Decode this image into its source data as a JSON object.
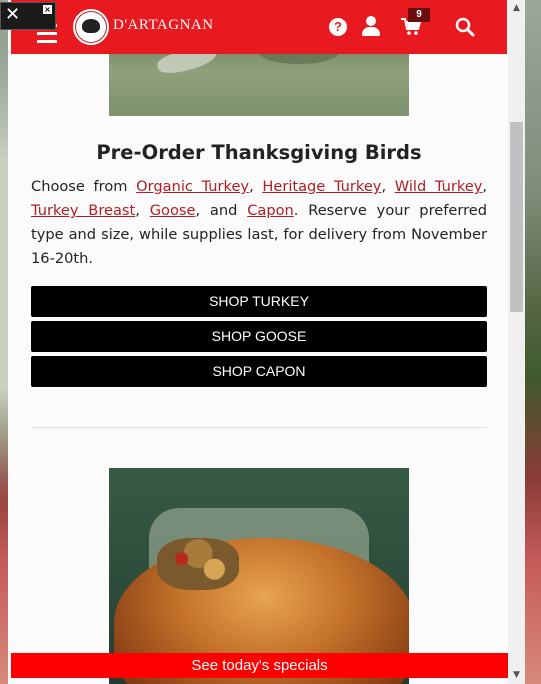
{
  "header": {
    "brand": "D'ARTAGNAN",
    "cart_count": "9",
    "help_label": "?"
  },
  "devtool": {
    "close_label": "×"
  },
  "section": {
    "title": "Pre-Order Thanksgiving Birds",
    "intro_text": "Choose from",
    "links": [
      "Organic Turkey",
      "Heritage Turkey",
      "Wild Turkey",
      "Turkey Breast",
      "Goose",
      "Capon"
    ],
    "connector_and": "and",
    "tail_text": ". Reserve your preferred type and size, while supplies last, for delivery from November 16-20th.",
    "buttons": [
      "SHOP TURKEY",
      "SHOP GOOSE",
      "SHOP CAPON"
    ]
  },
  "footer_bar": {
    "label": "See today's specials"
  },
  "scrollbar": {
    "up": "▲",
    "down": "▼"
  },
  "colors": {
    "brand_red": "#e8191f",
    "link_red": "#b11e24",
    "specials_red": "#ff0000",
    "button_black": "#000000"
  },
  "icons": [
    "tools-icon",
    "close-icon",
    "hamburger-icon",
    "logo-icon",
    "help-icon",
    "user-icon",
    "cart-icon",
    "search-icon"
  ]
}
